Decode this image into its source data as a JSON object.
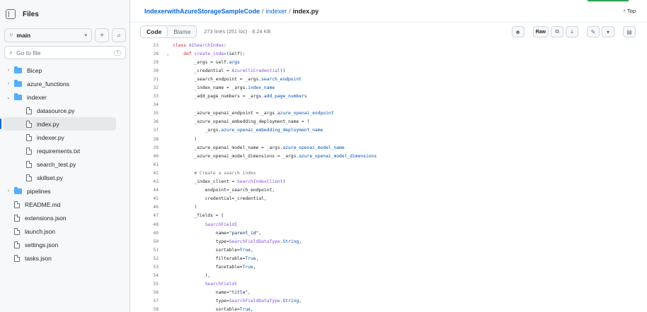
{
  "sidebar": {
    "title": "Files",
    "branch": "main",
    "goto_placeholder": "Go to file",
    "goto_kbd": "t",
    "tree": [
      {
        "label": "Bicep",
        "type": "folder",
        "depth": 0,
        "expanded": false
      },
      {
        "label": "azure_functions",
        "type": "folder",
        "depth": 0,
        "expanded": false
      },
      {
        "label": "indexer",
        "type": "folder",
        "depth": 0,
        "expanded": true
      },
      {
        "label": "datasource.py",
        "type": "file",
        "depth": 1
      },
      {
        "label": "index.py",
        "type": "file",
        "depth": 1,
        "active": true
      },
      {
        "label": "indexer.py",
        "type": "file",
        "depth": 1
      },
      {
        "label": "requirements.txt",
        "type": "file",
        "depth": 1
      },
      {
        "label": "search_test.py",
        "type": "file",
        "depth": 1
      },
      {
        "label": "skillset.py",
        "type": "file",
        "depth": 1
      },
      {
        "label": "pipelines",
        "type": "folder",
        "depth": 0,
        "expanded": false
      },
      {
        "label": "README.md",
        "type": "file",
        "depth": 0
      },
      {
        "label": "extensions.json",
        "type": "file",
        "depth": 0
      },
      {
        "label": "launch.json",
        "type": "file",
        "depth": 0
      },
      {
        "label": "settings.json",
        "type": "file",
        "depth": 0
      },
      {
        "label": "tasks.json",
        "type": "file",
        "depth": 0
      }
    ]
  },
  "header": {
    "repo": "IndexerwithAzureStorageSampleCode",
    "sep1": "/",
    "folder": "indexer",
    "sep2": "/",
    "file": "index.py",
    "top_label": "Top"
  },
  "toolbar": {
    "code_tab": "Code",
    "blame_tab": "Blame",
    "meta": "273 lines (251 loc) · 8.24 KB",
    "raw_label": "Raw"
  },
  "colors": {
    "accent": "#0969da",
    "folder": "#54aeff",
    "keyword": "#cf222e",
    "function": "#8250df",
    "attribute": "#0550ae"
  },
  "code": [
    {
      "n": "23",
      "fold": "",
      "tokens": [
        [
          "kw",
          "class "
        ],
        [
          "fn",
          "AISearchIndex"
        ],
        [
          "src",
          ":"
        ]
      ]
    },
    {
      "n": "28",
      "fold": "⌄",
      "tokens": [
        [
          "src",
          "    "
        ],
        [
          "kw",
          "def "
        ],
        [
          "fn",
          "create_index"
        ],
        [
          "src",
          "(self):"
        ]
      ]
    },
    {
      "n": "29",
      "fold": "",
      "tokens": [
        [
          "src",
          "        _args = self."
        ],
        [
          "at",
          "args"
        ]
      ]
    },
    {
      "n": "30",
      "fold": "",
      "tokens": [
        [
          "src",
          "        _credential = "
        ],
        [
          "fn",
          "AzureCliCredential"
        ],
        [
          "src",
          "()"
        ]
      ]
    },
    {
      "n": "31",
      "fold": "",
      "tokens": [
        [
          "src",
          "        _search_endpoint = _args."
        ],
        [
          "at",
          "search_endpoint"
        ]
      ]
    },
    {
      "n": "32",
      "fold": "",
      "tokens": [
        [
          "src",
          "        _index_name = _args."
        ],
        [
          "at",
          "index_name"
        ]
      ]
    },
    {
      "n": "33",
      "fold": "",
      "tokens": [
        [
          "src",
          "        _add_page_numbers = _args."
        ],
        [
          "at",
          "add_page_numbers"
        ]
      ]
    },
    {
      "n": "34",
      "fold": "",
      "tokens": []
    },
    {
      "n": "35",
      "fold": "",
      "tokens": [
        [
          "src",
          "        _azure_openai_endpoint = _args."
        ],
        [
          "at",
          "azure_openai_endpoint"
        ]
      ]
    },
    {
      "n": "36",
      "fold": "",
      "tokens": [
        [
          "src",
          "        _azure_openai_embedding_deployment_name = ("
        ]
      ]
    },
    {
      "n": "37",
      "fold": "",
      "tokens": [
        [
          "src",
          "            _args."
        ],
        [
          "at",
          "azure_openai_embedding_deployment_name"
        ]
      ]
    },
    {
      "n": "38",
      "fold": "",
      "tokens": [
        [
          "src",
          "        )"
        ]
      ]
    },
    {
      "n": "39",
      "fold": "",
      "tokens": [
        [
          "src",
          "        _azure_openai_model_name = _args."
        ],
        [
          "at",
          "azure_openai_model_name"
        ]
      ]
    },
    {
      "n": "40",
      "fold": "",
      "tokens": [
        [
          "src",
          "        _azure_openai_model_dimensions = _args."
        ],
        [
          "at",
          "azure_openai_model_dimensions"
        ]
      ]
    },
    {
      "n": "41",
      "fold": "",
      "tokens": []
    },
    {
      "n": "42",
      "fold": "",
      "tokens": [
        [
          "cm",
          "        # Create a search index"
        ]
      ]
    },
    {
      "n": "43",
      "fold": "",
      "tokens": [
        [
          "src",
          "        _index_client = "
        ],
        [
          "fn",
          "SearchIndexClient"
        ],
        [
          "src",
          "("
        ]
      ]
    },
    {
      "n": "44",
      "fold": "",
      "tokens": [
        [
          "src",
          "            endpoint=_search_endpoint,"
        ]
      ]
    },
    {
      "n": "45",
      "fold": "",
      "tokens": [
        [
          "src",
          "            credential=_credential,"
        ]
      ]
    },
    {
      "n": "46",
      "fold": "",
      "tokens": [
        [
          "src",
          "        )"
        ]
      ]
    },
    {
      "n": "47",
      "fold": "",
      "tokens": [
        [
          "src",
          "        _fields = ["
        ]
      ]
    },
    {
      "n": "48",
      "fold": "",
      "tokens": [
        [
          "src",
          "            "
        ],
        [
          "fn",
          "SearchField"
        ],
        [
          "src",
          "("
        ]
      ]
    },
    {
      "n": "49",
      "fold": "",
      "tokens": [
        [
          "src",
          "                name="
        ],
        [
          "st",
          "\"parent_id\""
        ],
        [
          "src",
          ","
        ]
      ]
    },
    {
      "n": "50",
      "fold": "",
      "tokens": [
        [
          "src",
          "                type="
        ],
        [
          "fn",
          "SearchFieldDataType"
        ],
        [
          "src",
          "."
        ],
        [
          "at",
          "String"
        ],
        [
          "src",
          ","
        ]
      ]
    },
    {
      "n": "51",
      "fold": "",
      "tokens": [
        [
          "src",
          "                sortable="
        ],
        [
          "ok",
          "True"
        ],
        [
          "src",
          ","
        ]
      ]
    },
    {
      "n": "52",
      "fold": "",
      "tokens": [
        [
          "src",
          "                filterable="
        ],
        [
          "ok",
          "True"
        ],
        [
          "src",
          ","
        ]
      ]
    },
    {
      "n": "53",
      "fold": "",
      "tokens": [
        [
          "src",
          "                facetable="
        ],
        [
          "ok",
          "True"
        ],
        [
          "src",
          ","
        ]
      ]
    },
    {
      "n": "54",
      "fold": "",
      "tokens": [
        [
          "src",
          "            ),"
        ]
      ]
    },
    {
      "n": "55",
      "fold": "",
      "tokens": [
        [
          "src",
          "            "
        ],
        [
          "fn",
          "SearchField"
        ],
        [
          "src",
          "("
        ]
      ]
    },
    {
      "n": "56",
      "fold": "",
      "tokens": [
        [
          "src",
          "                name="
        ],
        [
          "st",
          "\"title\""
        ],
        [
          "src",
          ","
        ]
      ]
    },
    {
      "n": "57",
      "fold": "",
      "tokens": [
        [
          "src",
          "                type="
        ],
        [
          "fn",
          "SearchFieldDataType"
        ],
        [
          "src",
          "."
        ],
        [
          "at",
          "String"
        ],
        [
          "src",
          ","
        ]
      ]
    },
    {
      "n": "58",
      "fold": "",
      "tokens": [
        [
          "src",
          "                sortable="
        ],
        [
          "ok",
          "True"
        ],
        [
          "src",
          ","
        ]
      ]
    }
  ]
}
